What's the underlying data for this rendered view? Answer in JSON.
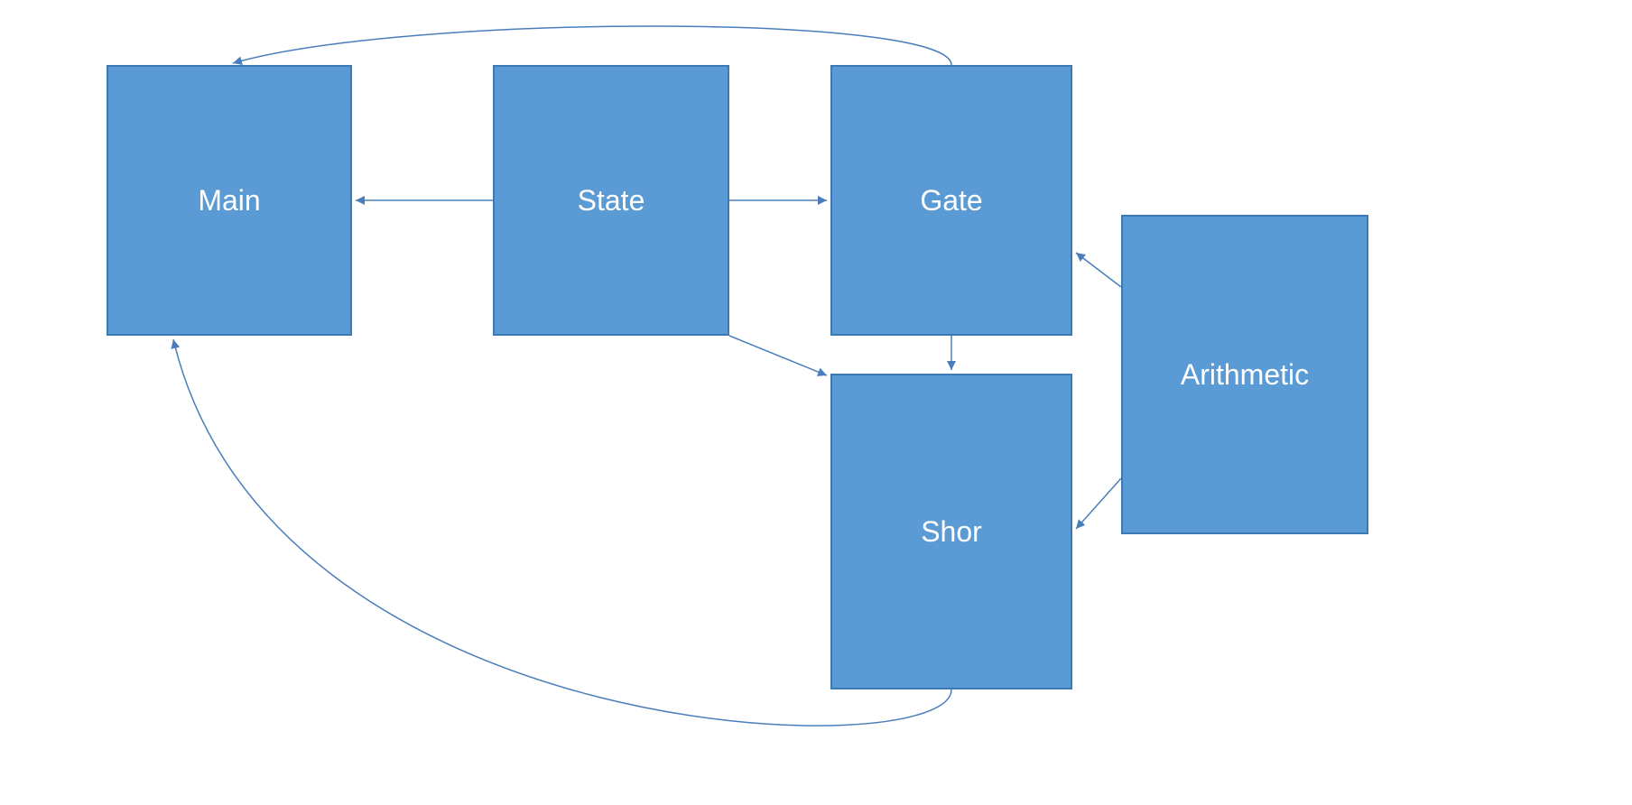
{
  "diagram": {
    "nodes": {
      "main": {
        "label": "Main"
      },
      "state": {
        "label": "State"
      },
      "gate": {
        "label": "Gate"
      },
      "shor": {
        "label": "Shor"
      },
      "arithmetic": {
        "label": "Arithmetic"
      }
    },
    "edges": [
      {
        "from": "State",
        "to": "Main",
        "style": "straight"
      },
      {
        "from": "State",
        "to": "Gate",
        "style": "straight"
      },
      {
        "from": "Gate",
        "to": "Shor",
        "style": "straight"
      },
      {
        "from": "State",
        "to": "Shor",
        "style": "straight"
      },
      {
        "from": "Gate",
        "to": "Main",
        "style": "curved"
      },
      {
        "from": "Shor",
        "to": "Main",
        "style": "curved"
      },
      {
        "from": "Arithmetic",
        "to": "Gate",
        "style": "straight"
      },
      {
        "from": "Arithmetic",
        "to": "Shor",
        "style": "straight"
      }
    ],
    "colors": {
      "nodeFill": "#5b9bd5",
      "nodeStroke": "#3c7ab5",
      "connector": "#4a7ebb"
    }
  }
}
